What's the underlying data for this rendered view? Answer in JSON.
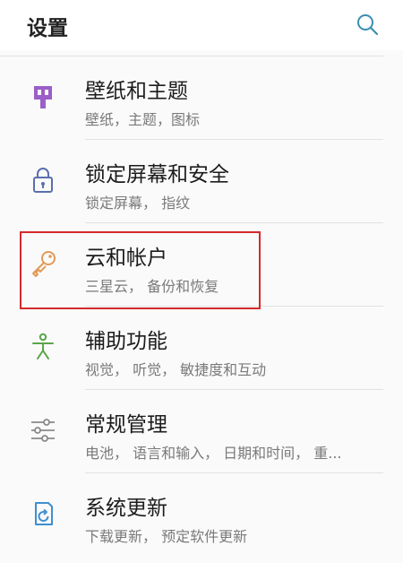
{
  "header": {
    "title": "设置"
  },
  "items": [
    {
      "label": "壁纸和主题",
      "sub": "壁纸，主题，图标"
    },
    {
      "label": "锁定屏幕和安全",
      "sub": "锁定屏幕， 指纹"
    },
    {
      "label": "云和帐户",
      "sub": "三星云， 备份和恢复"
    },
    {
      "label": "辅助功能",
      "sub": "视觉， 听觉， 敏捷度和互动"
    },
    {
      "label": "常规管理",
      "sub": "电池， 语言和输入， 日期和时间， 重..."
    },
    {
      "label": "系统更新",
      "sub": "下载更新， 预定软件更新"
    }
  ],
  "colors": {
    "wallpaper_icon": "#9b5fc8",
    "lock_icon": "#5a6fae",
    "cloud_icon": "#e29a55",
    "accessibility_icon": "#5aa64a",
    "general_icon": "#8a8a8a",
    "update_icon": "#3e8fd0",
    "highlight": "#d42a2a"
  }
}
